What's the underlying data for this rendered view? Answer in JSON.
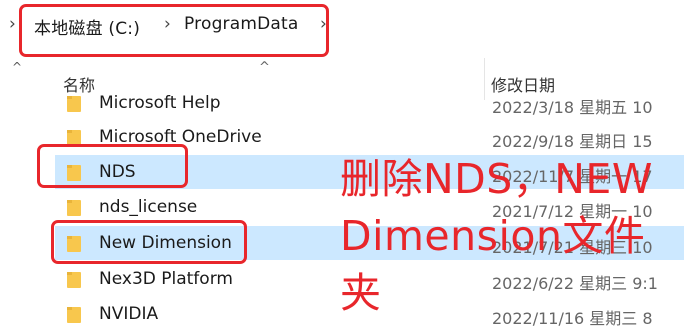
{
  "address_bar": {
    "crumbs": [
      {
        "label": "本地磁盘 (C:)"
      },
      {
        "label": "ProgramData"
      }
    ]
  },
  "columns": {
    "name": "名称",
    "date_modified": "修改日期"
  },
  "rows": [
    {
      "name": "Microsoft Help",
      "date": "2022/3/18 星期五 10",
      "selected": false
    },
    {
      "name": "Microsoft OneDrive",
      "date": "2022/9/18 星期日 15",
      "selected": false
    },
    {
      "name": "NDS",
      "date": "2022/11/7 星期一 17",
      "selected": true
    },
    {
      "name": "nds_license",
      "date": "2021/7/12 星期一 10",
      "selected": false
    },
    {
      "name": "New Dimension",
      "date": "2021/7/21 星期三 10",
      "selected": true
    },
    {
      "name": "Nex3D Platform",
      "date": "2022/6/22 星期三 9:1",
      "selected": false
    },
    {
      "name": "NVIDIA",
      "date": "2022/11/16 星期三 8",
      "selected": false
    }
  ],
  "annotation": {
    "lines": [
      "删除NDS，NEW",
      "Dimension文件",
      "夹"
    ]
  },
  "colors": {
    "annotation_red": "#e8262b",
    "selection_blue": "#cce8ff",
    "folder_yellow": "#f8c74d"
  },
  "icons": {
    "folder": "folder-icon",
    "chevron_right": "chevron-right-icon",
    "sort": "sort-chevron-up-icon",
    "scroll_up": "scroll-up-arrow-icon"
  }
}
